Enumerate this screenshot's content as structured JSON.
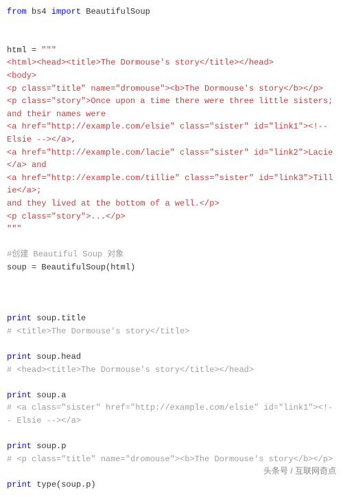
{
  "code": {
    "l1_from": "from",
    "l1_mod": "bs4",
    "l1_import": "import",
    "l1_cls": "BeautifulSoup",
    "l2_var": "html = ",
    "l2_q": "\"\"\"",
    "l3": "<html><head><title>The Dormouse's story</title></head>",
    "l4": "<body>",
    "l5": "<p class=\"title\" name=\"dromouse\"><b>The Dormouse's story</b></p>",
    "l6": "<p class=\"story\">Once upon a time there were three little sisters; and their names were",
    "l7": "<a href=\"http://example.com/elsie\" class=\"sister\" id=\"link1\"><!-- Elsie --></a>,",
    "l8": "<a href=\"http://example.com/lacie\" class=\"sister\" id=\"link2\">Lacie</a> and",
    "l9": "<a href=\"http://example.com/tillie\" class=\"sister\" id=\"link3\">Tillie</a>;",
    "l10": "and they lived at the bottom of a well.</p>",
    "l11": "<p class=\"story\">...</p>",
    "l12": "\"\"\"",
    "l13": "#创建 Beautiful Soup 对象",
    "l14a": "soup = BeautifulSoup(html)",
    "l15p": "print",
    "l15r": " soup.title",
    "l16": "# <title>The Dormouse's story</title>",
    "l17p": "print",
    "l17r": " soup.head",
    "l18": "# <head><title>The Dormouse's story</title></head>",
    "l19p": "print",
    "l19r": " soup.a",
    "l20": "# <a class=\"sister\" href=\"http://example.com/elsie\" id=\"link1\"><!-- Elsie --></a>",
    "l21p": "print",
    "l21r": " soup.p",
    "l22": "# <p class=\"title\" name=\"dromouse\"><b>The Dormouse's story</b></p>",
    "l23p": "print",
    "l23r": " type(soup.p)"
  },
  "watermark": "头条号 / 互联网奇点"
}
